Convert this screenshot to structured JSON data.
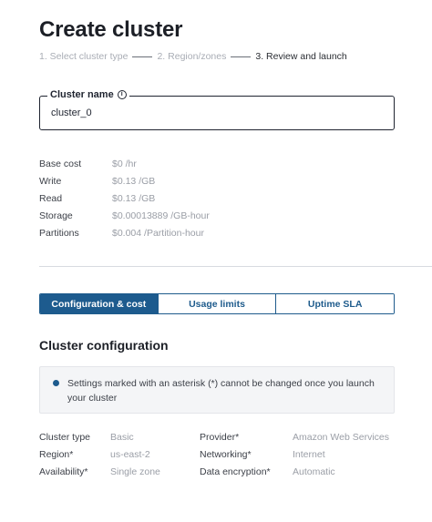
{
  "page": {
    "title": "Create cluster"
  },
  "stepper": {
    "steps": [
      {
        "label": "1. Select cluster type"
      },
      {
        "label": "2. Region/zones"
      },
      {
        "label": "3. Review and launch"
      }
    ]
  },
  "cluster_name": {
    "label": "Cluster name",
    "value": "cluster_0"
  },
  "costs": [
    {
      "label": "Base cost",
      "value": "$0 /hr"
    },
    {
      "label": "Write",
      "value": "$0.13 /GB"
    },
    {
      "label": "Read",
      "value": "$0.13 /GB"
    },
    {
      "label": "Storage",
      "value": "$0.00013889 /GB-hour"
    },
    {
      "label": "Partitions",
      "value": "$0.004 /Partition-hour"
    }
  ],
  "tabs": [
    {
      "label": "Configuration & cost"
    },
    {
      "label": "Usage limits"
    },
    {
      "label": "Uptime SLA"
    }
  ],
  "config": {
    "title": "Cluster configuration",
    "notice": "Settings marked with an asterisk (*) cannot be changed once you launch your cluster",
    "rows": [
      {
        "l1": "Cluster type",
        "v1": "Basic",
        "l2": "Provider*",
        "v2": "Amazon Web Services"
      },
      {
        "l1": "Region*",
        "v1": "us-east-2",
        "l2": "Networking*",
        "v2": "Internet"
      },
      {
        "l1": "Availability*",
        "v1": "Single zone",
        "l2": "Data encryption*",
        "v2": "Automatic"
      }
    ]
  },
  "colors": {
    "accent": "#1d5b8e",
    "text": "#1f2430",
    "muted": "#9a9ea6"
  }
}
